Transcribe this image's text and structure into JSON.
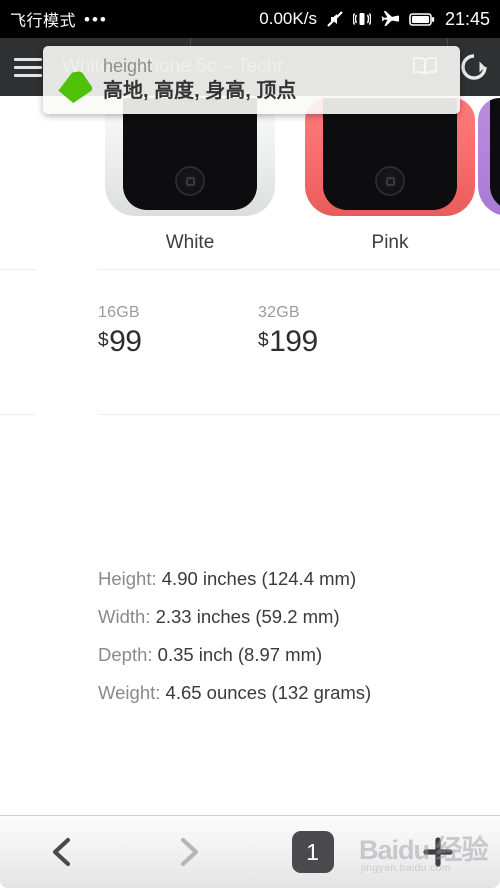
{
  "statusbar": {
    "mode": "飞行模式",
    "dots": "•••",
    "speed": "0.00K/s",
    "time": "21:45",
    "icons": [
      "mute-icon",
      "vibrate-icon",
      "airplane-icon",
      "battery-icon"
    ]
  },
  "browser": {
    "title": "White – iPhone 5c – Techr",
    "menu_icon": "hamburger-menu-icon",
    "book_icon": "reader-mode-icon",
    "reload_icon": "reload-icon"
  },
  "dictionary": {
    "tag_icon": "green-tag-icon",
    "word": "height",
    "definitions": "高地, 高度, 身高, 顶点"
  },
  "page": {
    "phones": [
      {
        "label": "White",
        "color_class": "white"
      },
      {
        "label": "Pink",
        "color_class": "pink"
      }
    ],
    "prices": [
      {
        "capacity": "16GB",
        "currency": "$",
        "amount": "99"
      },
      {
        "capacity": "32GB",
        "currency": "$",
        "amount": "199"
      }
    ],
    "specs": [
      {
        "key": "Height:",
        "value": "4.90 inches (124.4 mm)"
      },
      {
        "key": "Width:",
        "value": "2.33 inches (59.2 mm)"
      },
      {
        "key": "Depth:",
        "value": "0.35 inch (8.97 mm)"
      },
      {
        "key": "Weight:",
        "value": "4.65 ounces (132 grams)"
      }
    ]
  },
  "navbar": {
    "back_icon": "chevron-left-icon",
    "forward_icon": "chevron-right-icon",
    "tab_count": "1",
    "add_icon": "plus-icon"
  },
  "watermark": {
    "brand": "Baidu 经验",
    "url": "jingyan.baidu.com"
  },
  "colors": {
    "status_bg": "#000000",
    "header_bg": "#2f3031",
    "accent_green": "#4ec208",
    "tab_badge": "#4a4a4e",
    "pink_phone": "#f96b6b"
  }
}
